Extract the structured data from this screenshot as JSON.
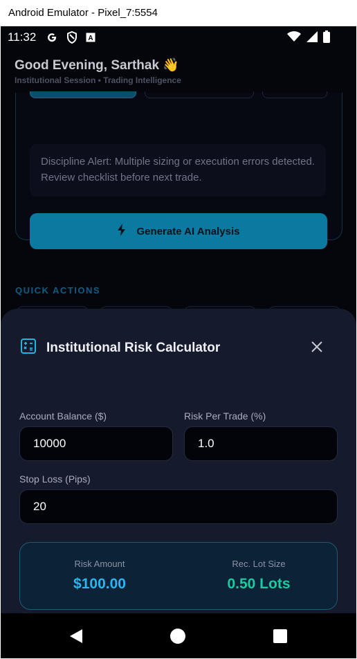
{
  "window": {
    "title": "Android Emulator - Pixel_7:5554"
  },
  "status_bar": {
    "time": "11:32",
    "icons": [
      "google-icon",
      "shield-icon",
      "keyboard-a-icon",
      "wifi-icon",
      "signal-icon",
      "battery-icon"
    ]
  },
  "header": {
    "greeting": "Good Evening, Sarthak 👋",
    "subtitle": "Institutional Session • Trading Intelligence"
  },
  "card": {
    "alert_text": "Discipline Alert: Multiple sizing or execution errors detected. Review checklist before next trade.",
    "generate_label": "Generate AI Analysis"
  },
  "quick_actions": {
    "title": "QUICK ACTIONS",
    "tiles": [
      "tile-1",
      "tile-2",
      "tile-3",
      "tile-4"
    ]
  },
  "calculator": {
    "title": "Institutional Risk Calculator",
    "balance_label": "Account Balance ($)",
    "balance_value": "10000",
    "risk_label": "Risk Per Trade (%)",
    "risk_value": "1.0",
    "stop_label": "Stop Loss (Pips)",
    "stop_value": "20",
    "risk_amount_label": "Risk Amount",
    "risk_amount_value": "$100.00",
    "lot_label": "Rec. Lot Size",
    "lot_value": "0.50 Lots"
  },
  "colors": {
    "accent": "#0a7aa1",
    "risk_amount": "#2bb5ee",
    "lot": "#1cc9a0",
    "sheet_bg": "#161a2d"
  }
}
